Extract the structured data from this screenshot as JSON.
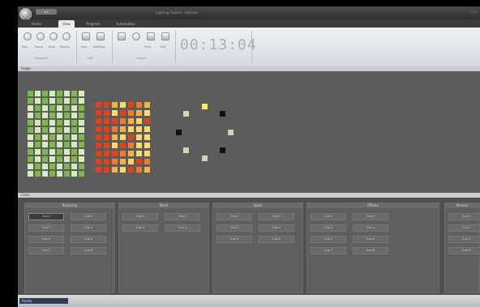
{
  "window": {
    "title": "Lighting Control - Untitled",
    "controls": "- □ ×"
  },
  "quick_access": "▾ ▾",
  "tabs": [
    "Home",
    "View",
    "Program",
    "Automation"
  ],
  "ribbon": {
    "buttons": [
      {
        "label": "Play",
        "icon": "play-icon"
      },
      {
        "label": "Pause",
        "icon": "pause-icon"
      },
      {
        "label": "Stop",
        "icon": "stop-icon"
      },
      {
        "label": "Add",
        "icon": "add-icon"
      },
      {
        "label": "Record",
        "icon": "record-icon"
      },
      {
        "label": "Settings",
        "icon": "gear-icon"
      },
      {
        "label": "Print",
        "icon": "print-icon"
      },
      {
        "label": "Exit",
        "icon": "exit-icon"
      }
    ],
    "groups": [
      "Transport",
      "Edit",
      "Output"
    ],
    "clock": "00:13:04"
  },
  "stage_panel": {
    "title": "Stage"
  },
  "cues_panel": {
    "title": "Cues"
  },
  "columns": [
    {
      "title": "Backdrop",
      "slots": [
        "Cue 1",
        "Cue 2",
        "Cue 3",
        "Cue 4",
        "Cue 5",
        "Cue 6",
        "Cue 7",
        "Cue 8"
      ]
    },
    {
      "title": "Wash",
      "slots": [
        "Cue 1",
        "Cue 2",
        "Cue 3",
        "Cue 4"
      ]
    },
    {
      "title": "Spots",
      "slots": [
        "Cue 1",
        "Cue 2",
        "Cue 3",
        "Cue 4",
        "Cue 5",
        "Cue 6"
      ]
    },
    {
      "title": "Effects",
      "slots": [
        "Cue 1",
        "Cue 2",
        "Cue 3",
        "Cue 4",
        "Cue 5",
        "Cue 6",
        "Cue 7",
        "Cue 8"
      ]
    },
    {
      "title": "Movers",
      "slots": [
        "Cue 1",
        "Cue 2",
        "Cue 3",
        "Cue 4"
      ]
    }
  ],
  "status": {
    "text": "Ready"
  },
  "colors": {
    "green_grid": [
      "#7fb84a",
      "#a7d27a",
      "#d6ecc0",
      "#eaf6df"
    ],
    "orange_grid": [
      "#e4411b",
      "#ef7a2a",
      "#f6b340",
      "#fbd96a"
    ],
    "ring": [
      "#e8f06a",
      "#111111",
      "#c9d9b0",
      "#111111",
      "#c9d9b0",
      "#c9d9b0",
      "#111111",
      "#c9d9b0"
    ]
  }
}
